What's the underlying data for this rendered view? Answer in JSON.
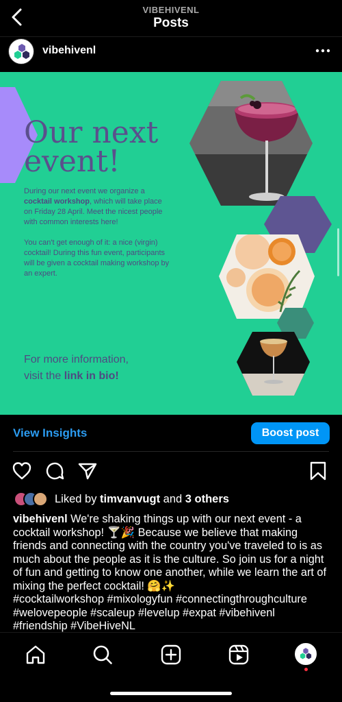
{
  "header": {
    "username_caption": "VIBEHIVENL",
    "title": "Posts"
  },
  "account": {
    "name": "vibehivenl"
  },
  "post_image": {
    "title_line1": "Our next",
    "title_line2": "event!",
    "desc_1a": "During our next event we organize a ",
    "desc_1b": "cocktail workshop",
    "desc_1c": ", which will take place on Friday 28 April. Meet the nicest people with common interests here!",
    "desc_2": "You can't get enough of it: a nice (virgin) cocktail! During this fun event, participants will be given a cocktail making workshop by an expert.",
    "more_1": "For more information,",
    "more_2a": "visit the ",
    "more_2b": "link in bio!",
    "colors": {
      "background": "#21cf94",
      "title_purple": "#5b4f8c",
      "accent_lavender": "#a78bfa",
      "hex_purple": "#5e5592"
    }
  },
  "actions": {
    "view_insights": "View Insights",
    "boost_post": "Boost post"
  },
  "likes": {
    "prefix": "Liked by ",
    "user": "timvanvugt",
    "middle": " and ",
    "others": "3 others"
  },
  "caption": {
    "username": "vibehivenl",
    "text": " We're shaking things up with our next event - a cocktail workshop! 🍸🎉 Because we believe that making friends and connecting with the country you've traveled to is as much about the people as it is the culture. So join us for a night of fun and getting to know one another, while we learn the art of mixing the perfect cocktail! 🤗✨",
    "hashtags": "#cocktailworkshop #mixologyfun #connectingthroughculture #welovepeople #scaleup #levelup #expat #vibehivenl #friendship  #VibeHiveNL"
  },
  "icons": {
    "back": "chevron-left-icon",
    "more": "more-dots-icon",
    "like": "heart-icon",
    "comment": "comment-icon",
    "share": "send-icon",
    "save": "bookmark-icon",
    "nav": [
      "home-icon",
      "search-icon",
      "create-icon",
      "reels-icon",
      "profile-avatar"
    ]
  },
  "colors": {
    "link_blue": "#2b9bf0",
    "button_blue": "#0095f6",
    "notification_red": "#ff3040"
  }
}
